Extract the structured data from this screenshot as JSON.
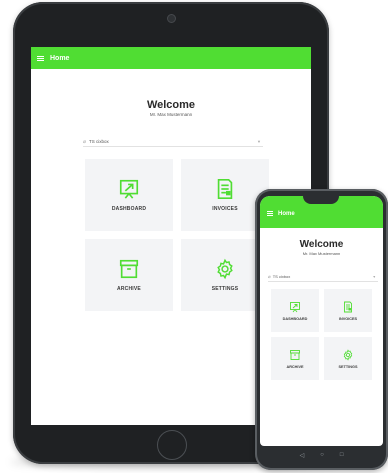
{
  "app": {
    "title": "Home",
    "welcome": "Welcome",
    "user": "Mr. Max Mustermann",
    "select_value": "TS cixbox",
    "tiles": [
      {
        "label": "DASHBOARD",
        "icon": "presentation-chart-icon"
      },
      {
        "label": "INVOICES",
        "icon": "invoice-document-icon"
      },
      {
        "label": "ARCHIVE",
        "icon": "archive-box-icon"
      },
      {
        "label": "SETTINGS",
        "icon": "gear-icon"
      }
    ]
  },
  "colors": {
    "accent": "#50dd33",
    "tile_bg": "#f3f4f6",
    "device_frame": "#1f2123"
  }
}
